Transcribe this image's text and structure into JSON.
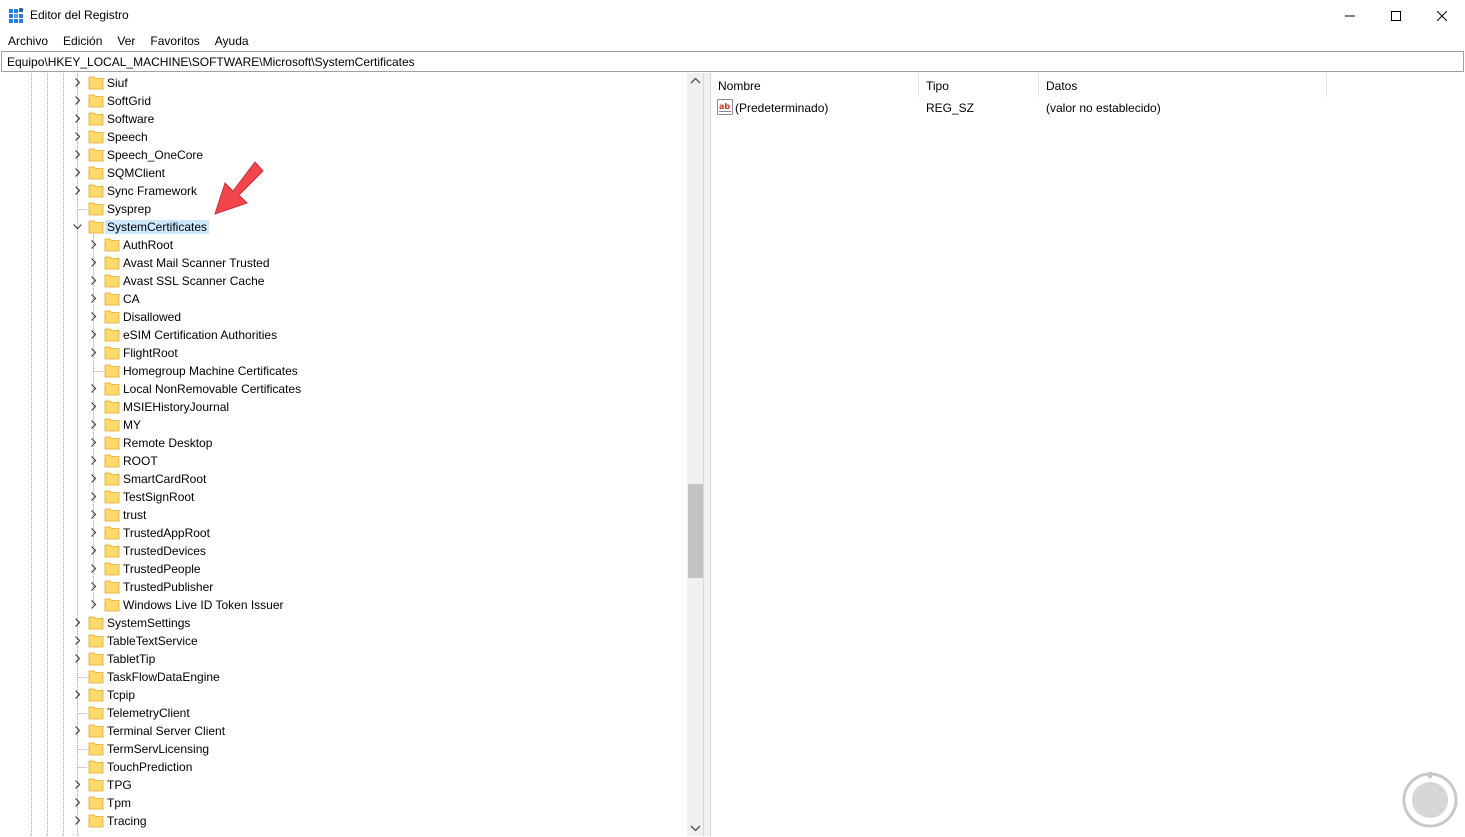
{
  "window": {
    "title": "Editor del Registro",
    "controls": {
      "minimize": "—",
      "maximize": "☐",
      "close": "✕"
    }
  },
  "menu": {
    "items": [
      "Archivo",
      "Edición",
      "Ver",
      "Favoritos",
      "Ayuda"
    ]
  },
  "address": {
    "path": "Equipo\\HKEY_LOCAL_MACHINE\\SOFTWARE\\Microsoft\\SystemCertificates"
  },
  "tree": {
    "selected": "SystemCertificates",
    "items": [
      {
        "label": "Siuf",
        "level": 0,
        "expand": "collapsed"
      },
      {
        "label": "SoftGrid",
        "level": 0,
        "expand": "collapsed"
      },
      {
        "label": "Software",
        "level": 0,
        "expand": "collapsed"
      },
      {
        "label": "Speech",
        "level": 0,
        "expand": "collapsed"
      },
      {
        "label": "Speech_OneCore",
        "level": 0,
        "expand": "collapsed"
      },
      {
        "label": "SQMClient",
        "level": 0,
        "expand": "collapsed"
      },
      {
        "label": "Sync Framework",
        "level": 0,
        "expand": "collapsed"
      },
      {
        "label": "Sysprep",
        "level": 0,
        "expand": "none"
      },
      {
        "label": "SystemCertificates",
        "level": 0,
        "expand": "expanded"
      },
      {
        "label": "AuthRoot",
        "level": 1,
        "expand": "collapsed"
      },
      {
        "label": "Avast Mail Scanner Trusted",
        "level": 1,
        "expand": "collapsed"
      },
      {
        "label": "Avast SSL Scanner Cache",
        "level": 1,
        "expand": "collapsed"
      },
      {
        "label": "CA",
        "level": 1,
        "expand": "collapsed"
      },
      {
        "label": "Disallowed",
        "level": 1,
        "expand": "collapsed"
      },
      {
        "label": "eSIM Certification Authorities",
        "level": 1,
        "expand": "collapsed"
      },
      {
        "label": "FlightRoot",
        "level": 1,
        "expand": "collapsed"
      },
      {
        "label": "Homegroup Machine Certificates",
        "level": 1,
        "expand": "none"
      },
      {
        "label": "Local NonRemovable Certificates",
        "level": 1,
        "expand": "collapsed"
      },
      {
        "label": "MSIEHistoryJournal",
        "level": 1,
        "expand": "collapsed"
      },
      {
        "label": "MY",
        "level": 1,
        "expand": "collapsed"
      },
      {
        "label": "Remote Desktop",
        "level": 1,
        "expand": "collapsed"
      },
      {
        "label": "ROOT",
        "level": 1,
        "expand": "collapsed"
      },
      {
        "label": "SmartCardRoot",
        "level": 1,
        "expand": "collapsed"
      },
      {
        "label": "TestSignRoot",
        "level": 1,
        "expand": "collapsed"
      },
      {
        "label": "trust",
        "level": 1,
        "expand": "collapsed"
      },
      {
        "label": "TrustedAppRoot",
        "level": 1,
        "expand": "collapsed"
      },
      {
        "label": "TrustedDevices",
        "level": 1,
        "expand": "collapsed"
      },
      {
        "label": "TrustedPeople",
        "level": 1,
        "expand": "collapsed"
      },
      {
        "label": "TrustedPublisher",
        "level": 1,
        "expand": "collapsed"
      },
      {
        "label": "Windows Live ID Token Issuer",
        "level": 1,
        "expand": "collapsed"
      },
      {
        "label": "SystemSettings",
        "level": 0,
        "expand": "collapsed"
      },
      {
        "label": "TableTextService",
        "level": 0,
        "expand": "collapsed"
      },
      {
        "label": "TabletTip",
        "level": 0,
        "expand": "collapsed"
      },
      {
        "label": "TaskFlowDataEngine",
        "level": 0,
        "expand": "none"
      },
      {
        "label": "Tcpip",
        "level": 0,
        "expand": "collapsed"
      },
      {
        "label": "TelemetryClient",
        "level": 0,
        "expand": "none"
      },
      {
        "label": "Terminal Server Client",
        "level": 0,
        "expand": "collapsed"
      },
      {
        "label": "TermServLicensing",
        "level": 0,
        "expand": "none"
      },
      {
        "label": "TouchPrediction",
        "level": 0,
        "expand": "none"
      },
      {
        "label": "TPG",
        "level": 0,
        "expand": "collapsed"
      },
      {
        "label": "Tpm",
        "level": 0,
        "expand": "collapsed"
      },
      {
        "label": "Tracing",
        "level": 0,
        "expand": "collapsed"
      }
    ]
  },
  "list": {
    "columns": [
      "Nombre",
      "Tipo",
      "Datos"
    ],
    "rows": [
      {
        "name": "(Predeterminado)",
        "type": "REG_SZ",
        "data": "(valor no establecido)",
        "icon": "string-value-icon"
      }
    ]
  },
  "colors": {
    "selection": "#cce8ff",
    "folder": "#ffd96b",
    "arrow": "#f2464c"
  },
  "scrollbar": {
    "position": 0.62
  }
}
